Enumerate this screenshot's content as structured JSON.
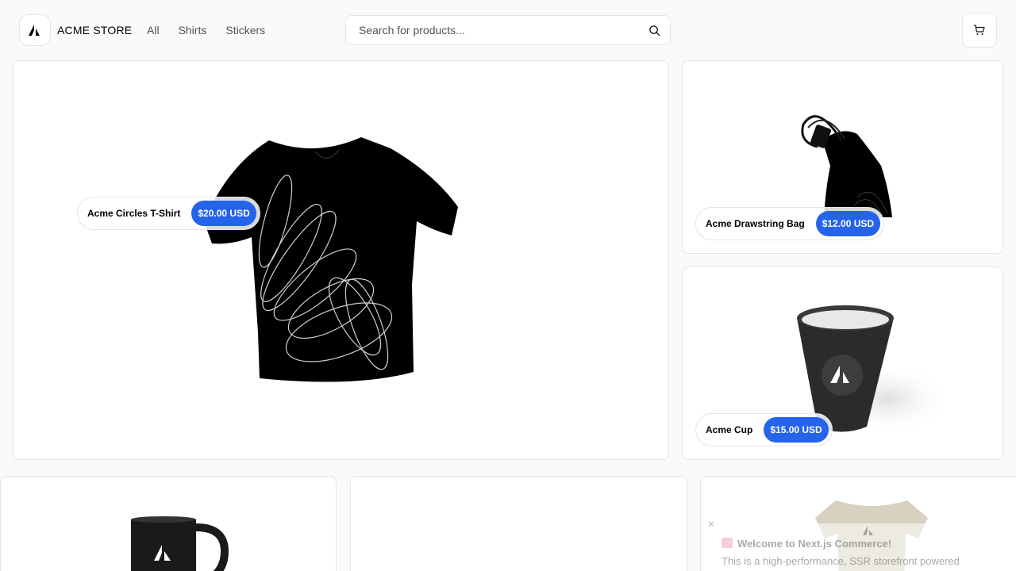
{
  "nav": {
    "brand": "ACME STORE",
    "links": [
      "All",
      "Shirts",
      "Stickers"
    ],
    "search_placeholder": "Search for products..."
  },
  "products": {
    "tshirt": {
      "name": "Acme Circles T-Shirt",
      "price": "$20.00 USD"
    },
    "bag": {
      "name": "Acme Drawstring Bag",
      "price": "$12.00 USD"
    },
    "cup": {
      "name": "Acme Cup",
      "price": "$15.00 USD"
    }
  },
  "toast": {
    "title": "Welcome to Next.js Commerce!",
    "body": "This is a high-performance, SSR storefront powered"
  },
  "colors": {
    "price_badge": "#2563eb",
    "background": "#fafafa"
  },
  "icons": [
    "acme-logo-icon",
    "search-icon",
    "cart-icon",
    "close-icon",
    "gift-icon"
  ]
}
